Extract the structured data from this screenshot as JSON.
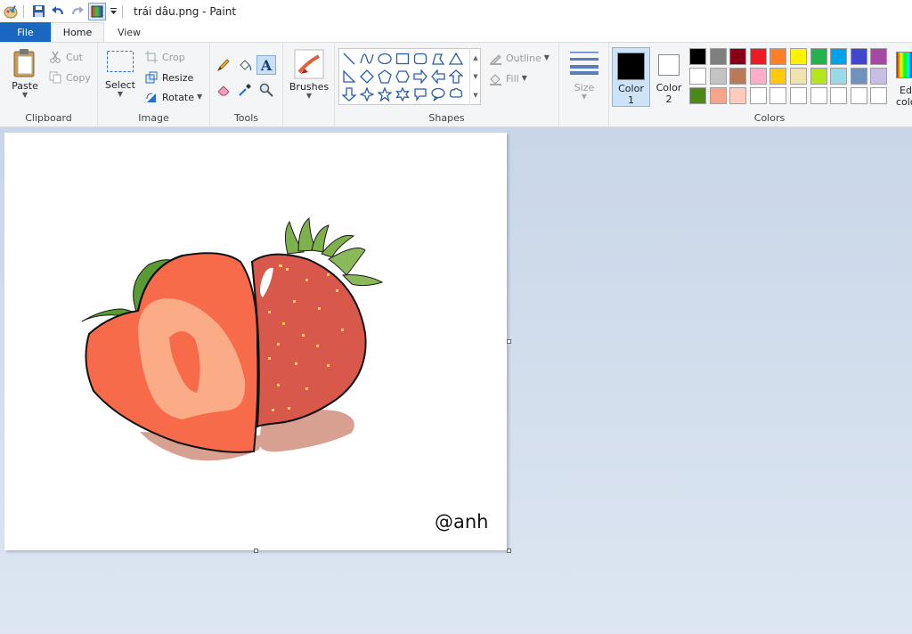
{
  "window": {
    "title": "trái dâu.png - Paint"
  },
  "tabs": [
    {
      "label": "File"
    },
    {
      "label": "Home"
    },
    {
      "label": "View"
    }
  ],
  "clipboard": {
    "paste": "Paste",
    "cut": "Cut",
    "copy": "Copy",
    "group_label": "Clipboard"
  },
  "image": {
    "select": "Select",
    "crop": "Crop",
    "resize": "Resize",
    "rotate": "Rotate",
    "group_label": "Image"
  },
  "tools": {
    "group_label": "Tools",
    "active_tool": "text-tool"
  },
  "brushes": {
    "label": "Brushes"
  },
  "shapes": {
    "outline": "Outline",
    "fill": "Fill",
    "group_label": "Shapes"
  },
  "size": {
    "label": "Size"
  },
  "colors": {
    "color1_label": "Color",
    "color1_num": "1",
    "color2_label": "Color",
    "color2_num": "2",
    "edit_label_1": "Ed",
    "edit_label_2": "colo",
    "group_label": "Colors",
    "color1": "#000000",
    "color2": "#ffffff",
    "palette_row1": [
      "#000000",
      "#7f7f7f",
      "#880015",
      "#ed1c24",
      "#ff7f27",
      "#fff200",
      "#22b14c",
      "#00a2e8",
      "#3f48cc",
      "#a349a4"
    ],
    "palette_row2": [
      "#ffffff",
      "#c3c3c3",
      "#b97a57",
      "#ffaec9",
      "#ffc90e",
      "#efe4b0",
      "#b5e61d",
      "#99d9ea",
      "#7092be",
      "#c8bfe7"
    ],
    "palette_row3": [
      "#4a8a1a",
      "#f4a58a",
      "#ffcbbd",
      "#ffffff",
      "#ffffff",
      "#ffffff",
      "#ffffff",
      "#ffffff",
      "#ffffff",
      "#ffffff"
    ]
  },
  "canvas": {
    "signature": "@anh"
  }
}
